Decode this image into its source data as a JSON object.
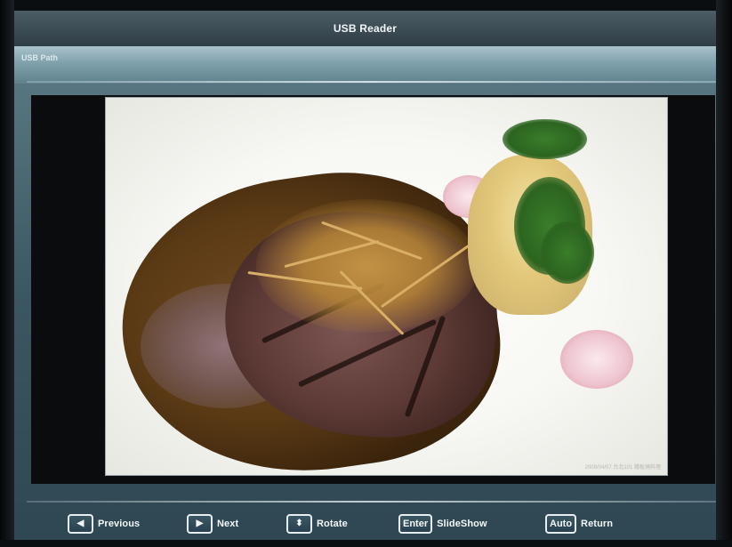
{
  "window": {
    "title": "USB Reader"
  },
  "path": {
    "label": "USB Path"
  },
  "photo": {
    "caption": "2009/04/07 台北101 鐵板燒料理"
  },
  "controls": [
    {
      "key": "◀",
      "key_kind": "left-arrow-icon",
      "label": "Previous"
    },
    {
      "key": "▶",
      "key_kind": "right-arrow-icon",
      "label": "Next"
    },
    {
      "key": "⬍",
      "key_kind": "up-down-arrow-icon",
      "label": "Rotate"
    },
    {
      "key": "Enter",
      "key_kind": "enter-key",
      "label": "SlideShow"
    },
    {
      "key": "Auto",
      "key_kind": "auto-key",
      "label": "Return"
    }
  ],
  "colors": {
    "accent": "#5a7883",
    "title_bar": "#2f3d45",
    "text": "#f4f8fa"
  }
}
